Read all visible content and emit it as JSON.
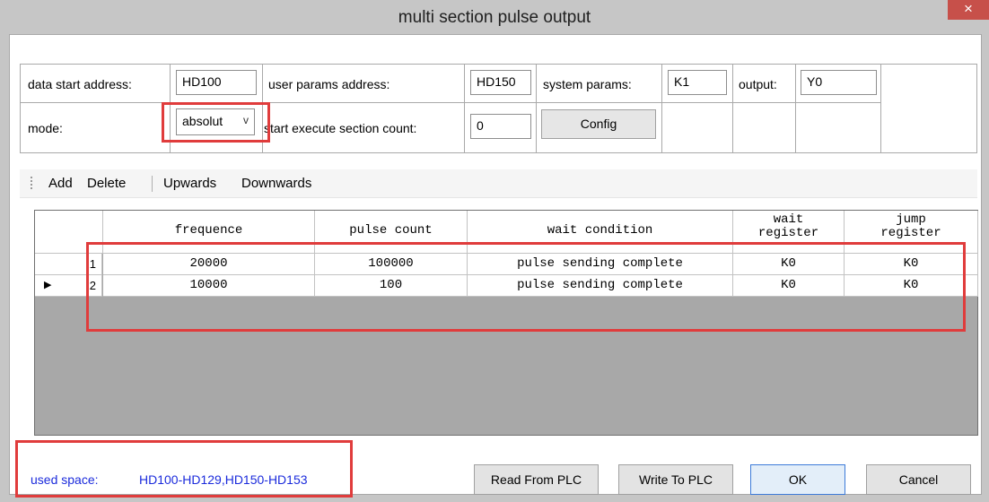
{
  "window": {
    "title": "multi section pulse output",
    "close_glyph": "×"
  },
  "params": {
    "data_start_address_label": "data start address:",
    "data_start_address_value": "HD100",
    "user_params_address_label": "user params address:",
    "user_params_address_value": "HD150",
    "system_params_label": "system params:",
    "system_params_value": "K1",
    "output_label": "output:",
    "output_value": "Y0",
    "mode_label": "mode:",
    "mode_value": "absolut",
    "mode_arrow_glyph": "v",
    "start_section_label": "start execute section count:",
    "start_section_value": "0",
    "config_button": "Config"
  },
  "toolbar": {
    "add": "Add",
    "delete": "Delete",
    "upwards": "Upwards",
    "downwards": "Downwards"
  },
  "grid": {
    "columns": [
      {
        "line1": "frequence",
        "line2": ""
      },
      {
        "line1": "pulse count",
        "line2": ""
      },
      {
        "line1": "wait condition",
        "line2": ""
      },
      {
        "line1": "wait",
        "line2": "register"
      },
      {
        "line1": "jump",
        "line2": "register"
      }
    ],
    "rows": [
      {
        "marker": "",
        "index": "1",
        "cells": [
          "20000",
          "100000",
          "pulse sending complete",
          "K0",
          "K0"
        ]
      },
      {
        "marker": "▶",
        "index": "2",
        "cells": [
          "10000",
          "100",
          "pulse sending complete",
          "K0",
          "K0"
        ]
      }
    ]
  },
  "status": {
    "used_space_label": "used space:",
    "used_space_value": "HD100-HD129,HD150-HD153"
  },
  "buttons": {
    "read": "Read From PLC",
    "write": "Write To PLC",
    "ok": "OK",
    "cancel": "Cancel"
  },
  "colors": {
    "highlight": "#e03c3c",
    "status_text": "#1b2bdc",
    "close_button": "#c7504a"
  }
}
